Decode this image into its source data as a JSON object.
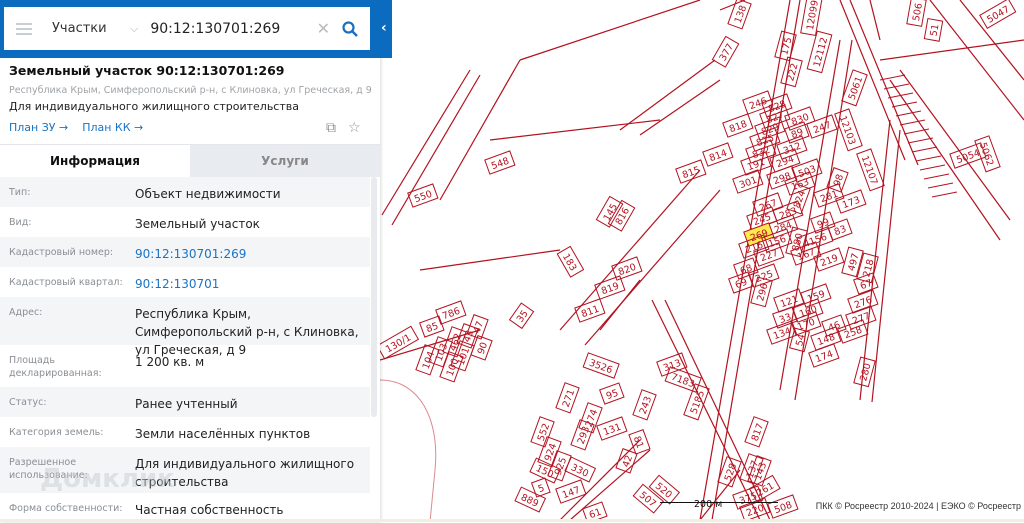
{
  "search": {
    "layer": "Участки",
    "query": "90:12:130701:269"
  },
  "object": {
    "title": "Земельный участок 90:12:130701:269",
    "address": "Республика Крым, Симферопольский р-н, с Клиновка, ул Греческая, д 9",
    "purpose": "Для индивидуального жилищного строительства",
    "link_plan_zu": "План ЗУ →",
    "link_plan_kk": "План КК →"
  },
  "tabs": {
    "info": "Информация",
    "services": "Услуги"
  },
  "rows": [
    {
      "label": "Тип:",
      "value": "Объект недвижимости"
    },
    {
      "label": "Вид:",
      "value": "Земельный участок"
    },
    {
      "label": "Кадастровый номер:",
      "value": "90:12:130701:269"
    },
    {
      "label": "Кадастровый квартал:",
      "value": "90:12:130701"
    },
    {
      "label": "Адрес:",
      "value": "Республика Крым, Симферопольский р-н, с Клиновка, ул Греческая, д 9"
    },
    {
      "label": "Площадь декларированная:",
      "value": "1 200 кв. м"
    },
    {
      "label": "Статус:",
      "value": "Ранее учтенный"
    },
    {
      "label": "Категория земель:",
      "value": "Земли населённых пунктов"
    },
    {
      "label": "Разрешенное использование:",
      "value": "Для индивидуального жилищного строительства"
    },
    {
      "label": "Форма собственности:",
      "value": "Частная собственность"
    }
  ],
  "watermark": "Домклик",
  "map": {
    "scale": "200 м",
    "copyright": "ПКК © Росреестр 2010-2024 | ЕЭКО © Росреестр",
    "selected": "269",
    "parcel_color": "#b3121f",
    "highlight_color": "#ffe94d",
    "parcels": [
      "246",
      "828",
      "827",
      "829",
      "825",
      "832",
      "191",
      "301",
      "818",
      "814",
      "815",
      "830",
      "247",
      "89",
      "312",
      "294",
      "503",
      "298",
      "163",
      "824",
      "267",
      "283",
      "281",
      "173",
      "98",
      "245",
      "284",
      "99",
      "83",
      "269",
      "156",
      "880",
      "4156",
      "216",
      "227",
      "167",
      "219",
      "497",
      "218",
      "68",
      "225",
      "69",
      "296",
      "67",
      "159",
      "121",
      "160",
      "276",
      "277",
      "33",
      "170",
      "46",
      "258",
      "134",
      "54",
      "148",
      "174",
      "280",
      "138",
      "377",
      "175",
      "222",
      "12112",
      "5061",
      "12103",
      "12107",
      "5054",
      "5062",
      "5047",
      "12099",
      "506",
      "51",
      "548",
      "550",
      "145",
      "816",
      "820",
      "819",
      "811",
      "183",
      "35",
      "85",
      "786",
      "130/1",
      "104",
      "103",
      "462",
      "101",
      "47",
      "43",
      "90",
      "100",
      "3526",
      "313",
      "7183",
      "5185",
      "817",
      "243",
      "95",
      "271",
      "274",
      "131",
      "552",
      "293",
      "924",
      "925",
      "81",
      "42",
      "330",
      "150",
      "889",
      "147",
      "61",
      "507",
      "520",
      "528",
      "137",
      "143",
      "261",
      "375",
      "220",
      "508",
      "5"
    ]
  }
}
